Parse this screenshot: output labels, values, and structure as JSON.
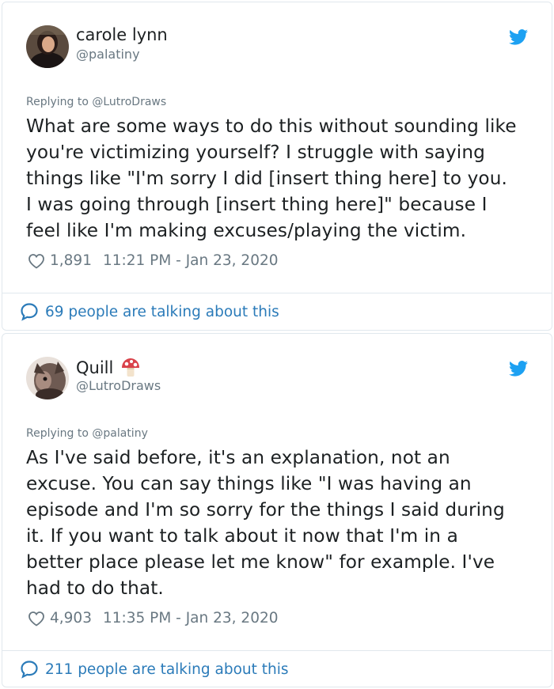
{
  "tweets": [
    {
      "author": {
        "name": "carole lynn",
        "handle": "@palatiny",
        "avatar_icon": "avatar-photo"
      },
      "replying_to": "Replying to @LutroDraws",
      "text_lines": [
        "What are some ways to do this without sounding like",
        "you're victimizing yourself? I struggle with saying",
        "things like \"I'm sorry I did [insert thing here] to you.",
        "I was going through [insert thing here]\" because I",
        "feel like I'm making excuses/playing the victim."
      ],
      "likes": "1,891",
      "timestamp": "11:21 PM - Jan 23, 2020",
      "talking": "69 people are talking about this"
    },
    {
      "author": {
        "name": "Quill",
        "handle": "@LutroDraws",
        "avatar_icon": "avatar-drawing",
        "emoji": "mushroom-icon"
      },
      "replying_to": "Replying to @palatiny",
      "text_lines": [
        "As I've said before, it's an explanation, not an",
        "excuse. You can say things like \"I was having an",
        "episode and I'm so sorry for the things I said during",
        "it. If you want to talk about it now that I'm in a",
        "better place please let me know\" for example. I've",
        "had to do that."
      ],
      "likes": "4,903",
      "timestamp": "11:35 PM - Jan 23, 2020",
      "talking": "211 people are talking about this"
    }
  ],
  "colors": {
    "text": "#1c2022",
    "muted": "#697882",
    "link": "#2b7bb9",
    "twitter_blue": "#1da1f2",
    "border": "#e1e8ed"
  }
}
